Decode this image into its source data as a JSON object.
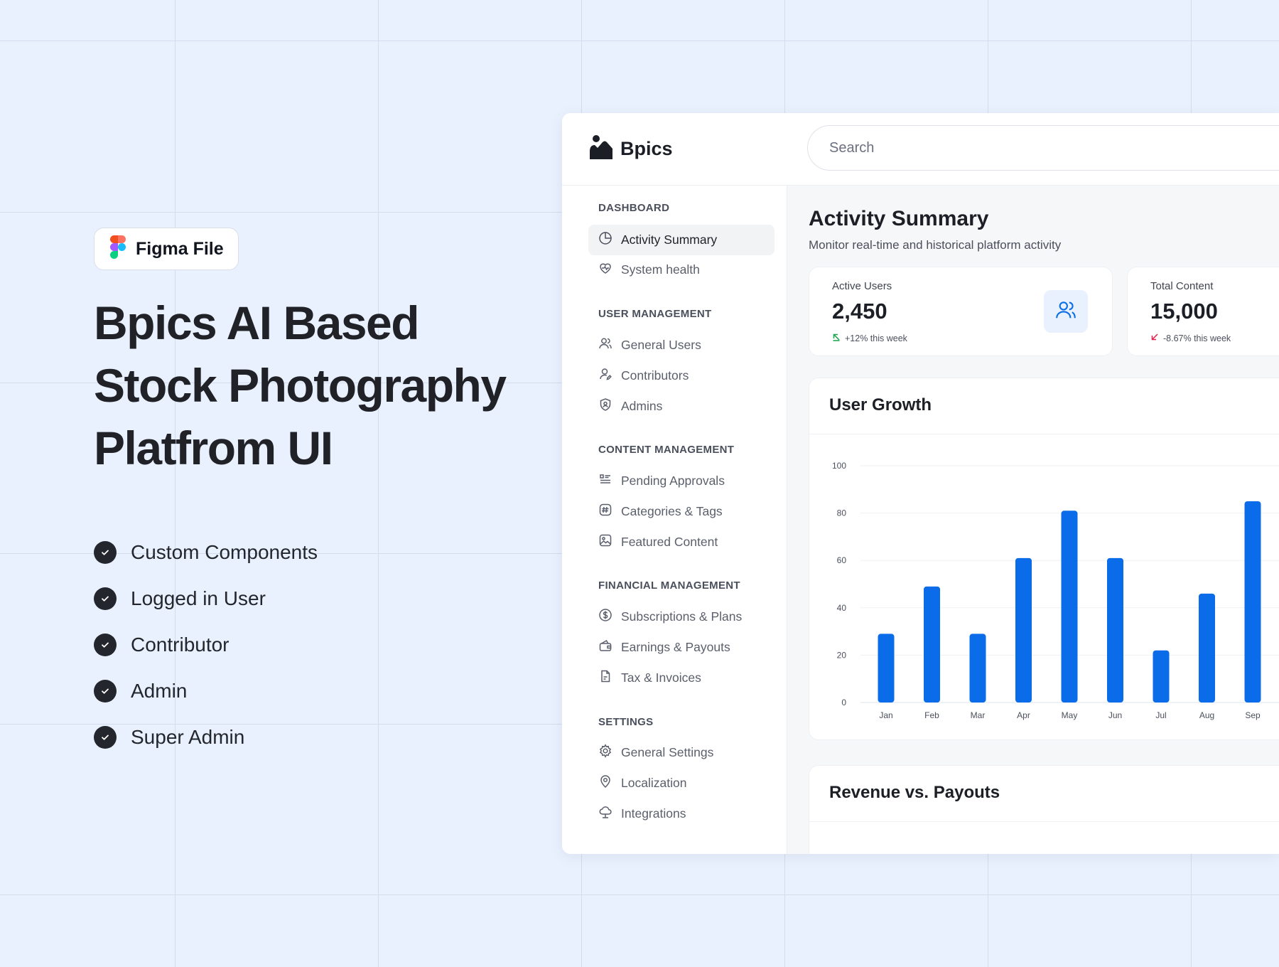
{
  "hero": {
    "badge_label": "Figma File",
    "title_lines": [
      "Bpics AI Based",
      "Stock Photography",
      "Platfrom UI"
    ],
    "features": [
      "Custom Components",
      "Logged in User",
      "Contributor",
      "Admin",
      "Super Admin"
    ]
  },
  "app": {
    "brand": "Bpics",
    "search_placeholder": "Search",
    "sidebar": {
      "sections": [
        {
          "title": "DASHBOARD",
          "items": [
            {
              "label": "Activity Summary",
              "icon": "pie-chart-icon",
              "active": true
            },
            {
              "label": "System health",
              "icon": "heart-pulse-icon",
              "active": false
            }
          ]
        },
        {
          "title": "USER MANAGEMENT",
          "items": [
            {
              "label": "General Users",
              "icon": "users-icon",
              "active": false
            },
            {
              "label": "Contributors",
              "icon": "user-edit-icon",
              "active": false
            },
            {
              "label": "Admins",
              "icon": "shield-user-icon",
              "active": false
            }
          ]
        },
        {
          "title": "CONTENT MANAGEMENT",
          "items": [
            {
              "label": "Pending Approvals",
              "icon": "list-icon",
              "active": false
            },
            {
              "label": "Categories & Tags",
              "icon": "hashtag-icon",
              "active": false
            },
            {
              "label": "Featured Content",
              "icon": "image-icon",
              "active": false
            }
          ]
        },
        {
          "title": "FINANCIAL MANAGEMENT",
          "items": [
            {
              "label": "Subscriptions & Plans",
              "icon": "dollar-circle-icon",
              "active": false
            },
            {
              "label": "Earnings & Payouts",
              "icon": "wallet-icon",
              "active": false
            },
            {
              "label": "Tax & Invoices",
              "icon": "document-icon",
              "active": false
            }
          ]
        },
        {
          "title": "SETTINGS",
          "items": [
            {
              "label": "General Settings",
              "icon": "gear-icon",
              "active": false
            },
            {
              "label": "Localization",
              "icon": "location-pin-icon",
              "active": false
            },
            {
              "label": "Integrations",
              "icon": "cloud-network-icon",
              "active": false
            }
          ]
        }
      ]
    },
    "main": {
      "title": "Activity Summary",
      "subtitle": "Monitor real-time and historical platform activity",
      "stats": [
        {
          "label": "Active Users",
          "value": "2,450",
          "trend": "+12% this week",
          "trend_dir": "up",
          "trend_color": "#16a34a"
        },
        {
          "label": "Total Content",
          "value": "15,000",
          "trend": "-8.67% this week",
          "trend_dir": "down",
          "trend_color": "#e11d48"
        }
      ],
      "user_growth_title": "User Growth",
      "revenue_title": "Revenue vs. Payouts"
    },
    "colors": {
      "accent": "#0a6ce8",
      "accent_light": "#e8f1fd"
    }
  },
  "chart_data": {
    "type": "bar",
    "title": "User Growth",
    "categories": [
      "Jan",
      "Feb",
      "Mar",
      "Apr",
      "May",
      "Jun",
      "Jul",
      "Aug",
      "Sep"
    ],
    "values": [
      29,
      49,
      29,
      61,
      81,
      61,
      22,
      46,
      85
    ],
    "ylim": [
      0,
      100
    ],
    "yticks": [
      0,
      20,
      40,
      60,
      80,
      100
    ],
    "grid": true,
    "color": "#0a6ce8"
  }
}
